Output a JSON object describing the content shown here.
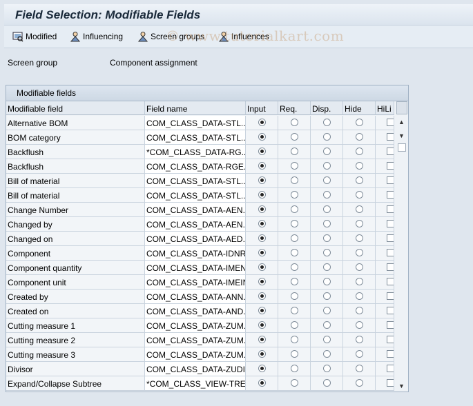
{
  "title": "Field Selection: Modifiable Fields",
  "toolbar": {
    "buttons": [
      {
        "label": "Modified",
        "icon": "display-icon"
      },
      {
        "label": "Influencing",
        "icon": "person-icon"
      },
      {
        "label": "Screen groups",
        "icon": "person-icon"
      },
      {
        "label": "Influences",
        "icon": "person-icon"
      }
    ]
  },
  "watermark": "© www.tutorialkart.com",
  "screen_group": {
    "label": "Screen group",
    "value": "Component assignment"
  },
  "table": {
    "title": "Modifiable fields",
    "columns": [
      "Modifiable field",
      "Field name",
      "Input",
      "Req.",
      "Disp.",
      "Hide",
      "HiLi"
    ],
    "rows": [
      {
        "field": "Alternative BOM",
        "name": "COM_CLASS_DATA-STL..."
      },
      {
        "field": "BOM category",
        "name": "COM_CLASS_DATA-STL..."
      },
      {
        "field": "Backflush",
        "name": "*COM_CLASS_DATA-RG..."
      },
      {
        "field": "Backflush",
        "name": "COM_CLASS_DATA-RGE..."
      },
      {
        "field": "Bill of material",
        "name": "COM_CLASS_DATA-STL..."
      },
      {
        "field": "Bill of material",
        "name": "COM_CLASS_DATA-STL..."
      },
      {
        "field": "Change Number",
        "name": "COM_CLASS_DATA-AEN..."
      },
      {
        "field": "Changed by",
        "name": "COM_CLASS_DATA-AEN..."
      },
      {
        "field": "Changed on",
        "name": "COM_CLASS_DATA-AED..."
      },
      {
        "field": "Component",
        "name": "COM_CLASS_DATA-IDNRK"
      },
      {
        "field": "Component quantity",
        "name": "COM_CLASS_DATA-IMEN..."
      },
      {
        "field": "Component unit",
        "name": "COM_CLASS_DATA-IMEIN"
      },
      {
        "field": "Created by",
        "name": "COM_CLASS_DATA-ANN..."
      },
      {
        "field": "Created on",
        "name": "COM_CLASS_DATA-AND..."
      },
      {
        "field": "Cutting measure 1",
        "name": "COM_CLASS_DATA-ZUM..."
      },
      {
        "field": "Cutting measure 2",
        "name": "COM_CLASS_DATA-ZUM..."
      },
      {
        "field": "Cutting measure 3",
        "name": "COM_CLASS_DATA-ZUM..."
      },
      {
        "field": "Divisor",
        "name": "COM_CLASS_DATA-ZUDI..."
      },
      {
        "field": "Expand/Collapse Subtree",
        "name": "*COM_CLASS_VIEW-TRE..."
      }
    ],
    "selected_option": "Input"
  },
  "colors": {
    "accent": "#1a2a3a",
    "background": "#dfe6ee"
  }
}
